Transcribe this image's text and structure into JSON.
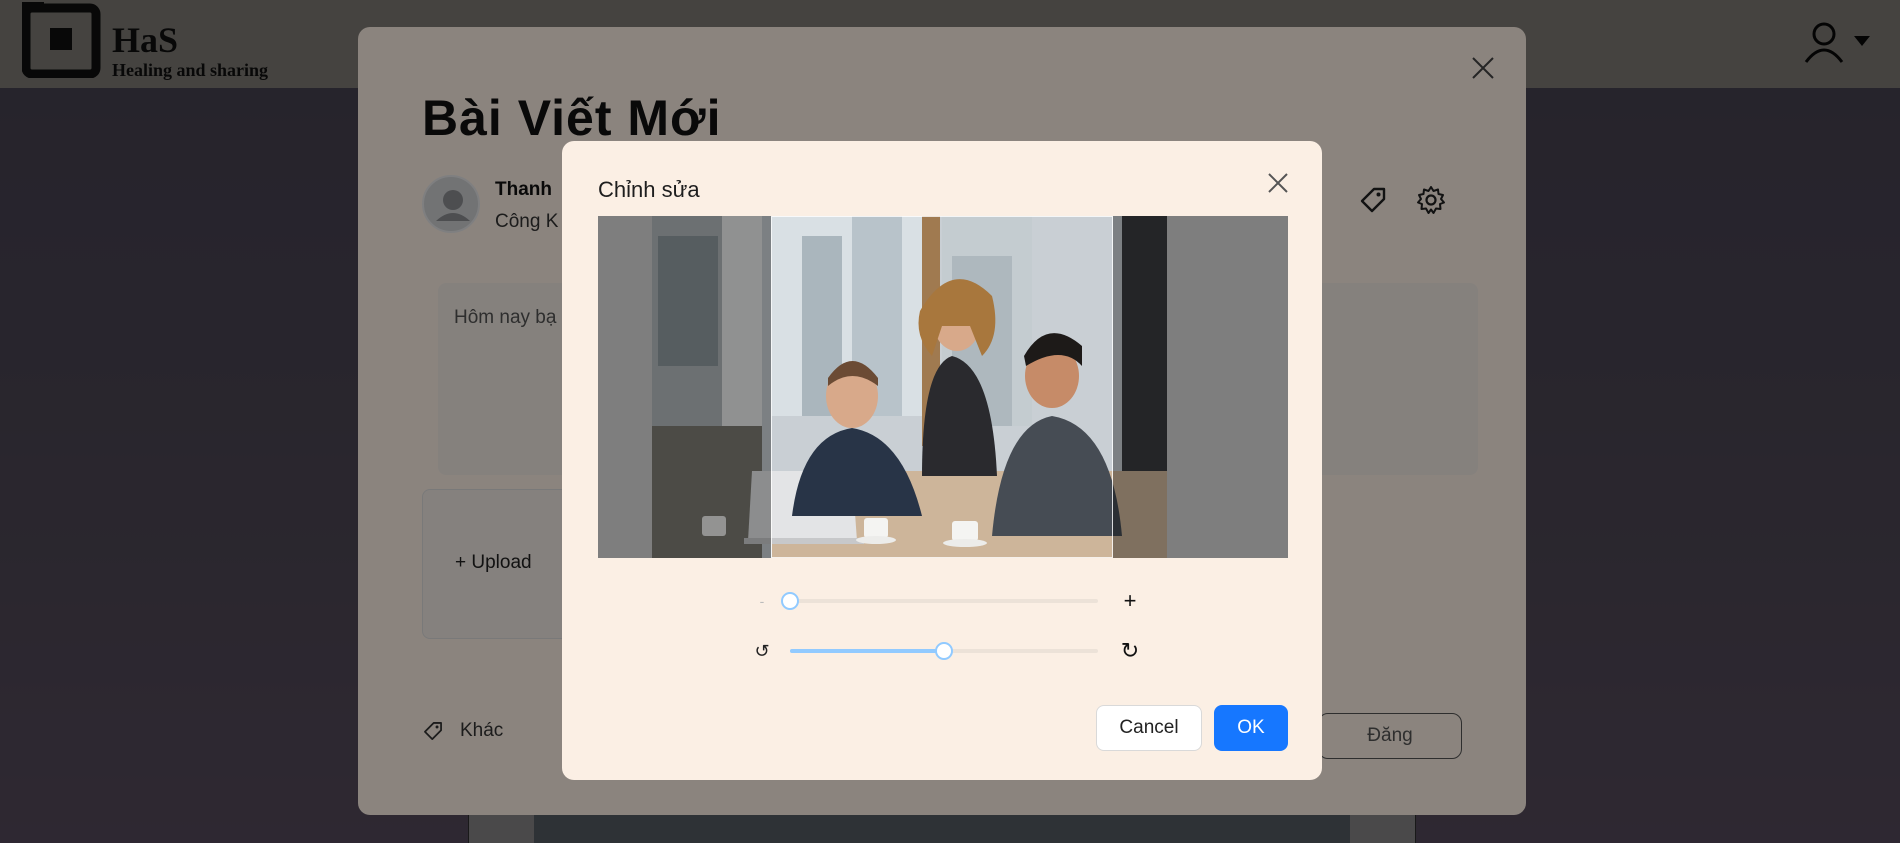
{
  "app": {
    "logo_title": "HaS",
    "logo_subtitle": "Healing and sharing",
    "user_icon": "user-icon"
  },
  "post_modal": {
    "title": "Bài Viết Mới",
    "user_name": "Thanh",
    "privacy": "Công K",
    "placeholder": "Hôm nay bạ",
    "upload_label": "+ Upload",
    "other_label": "Khác",
    "submit_label": "Đăng",
    "icons": [
      "close-icon",
      "tag-icon",
      "settings-icon"
    ]
  },
  "crop_modal": {
    "title": "Chỉnh sửa",
    "zoom": {
      "minus": "-",
      "plus": "+",
      "value": 0.0
    },
    "rotate": {
      "left": "↺",
      "right": "↻",
      "value": 0.5
    },
    "cancel_label": "Cancel",
    "ok_label": "OK"
  },
  "colors": {
    "primary": "#1677ff",
    "slider": "#91caff",
    "modal_bg": "#fbefe4"
  }
}
